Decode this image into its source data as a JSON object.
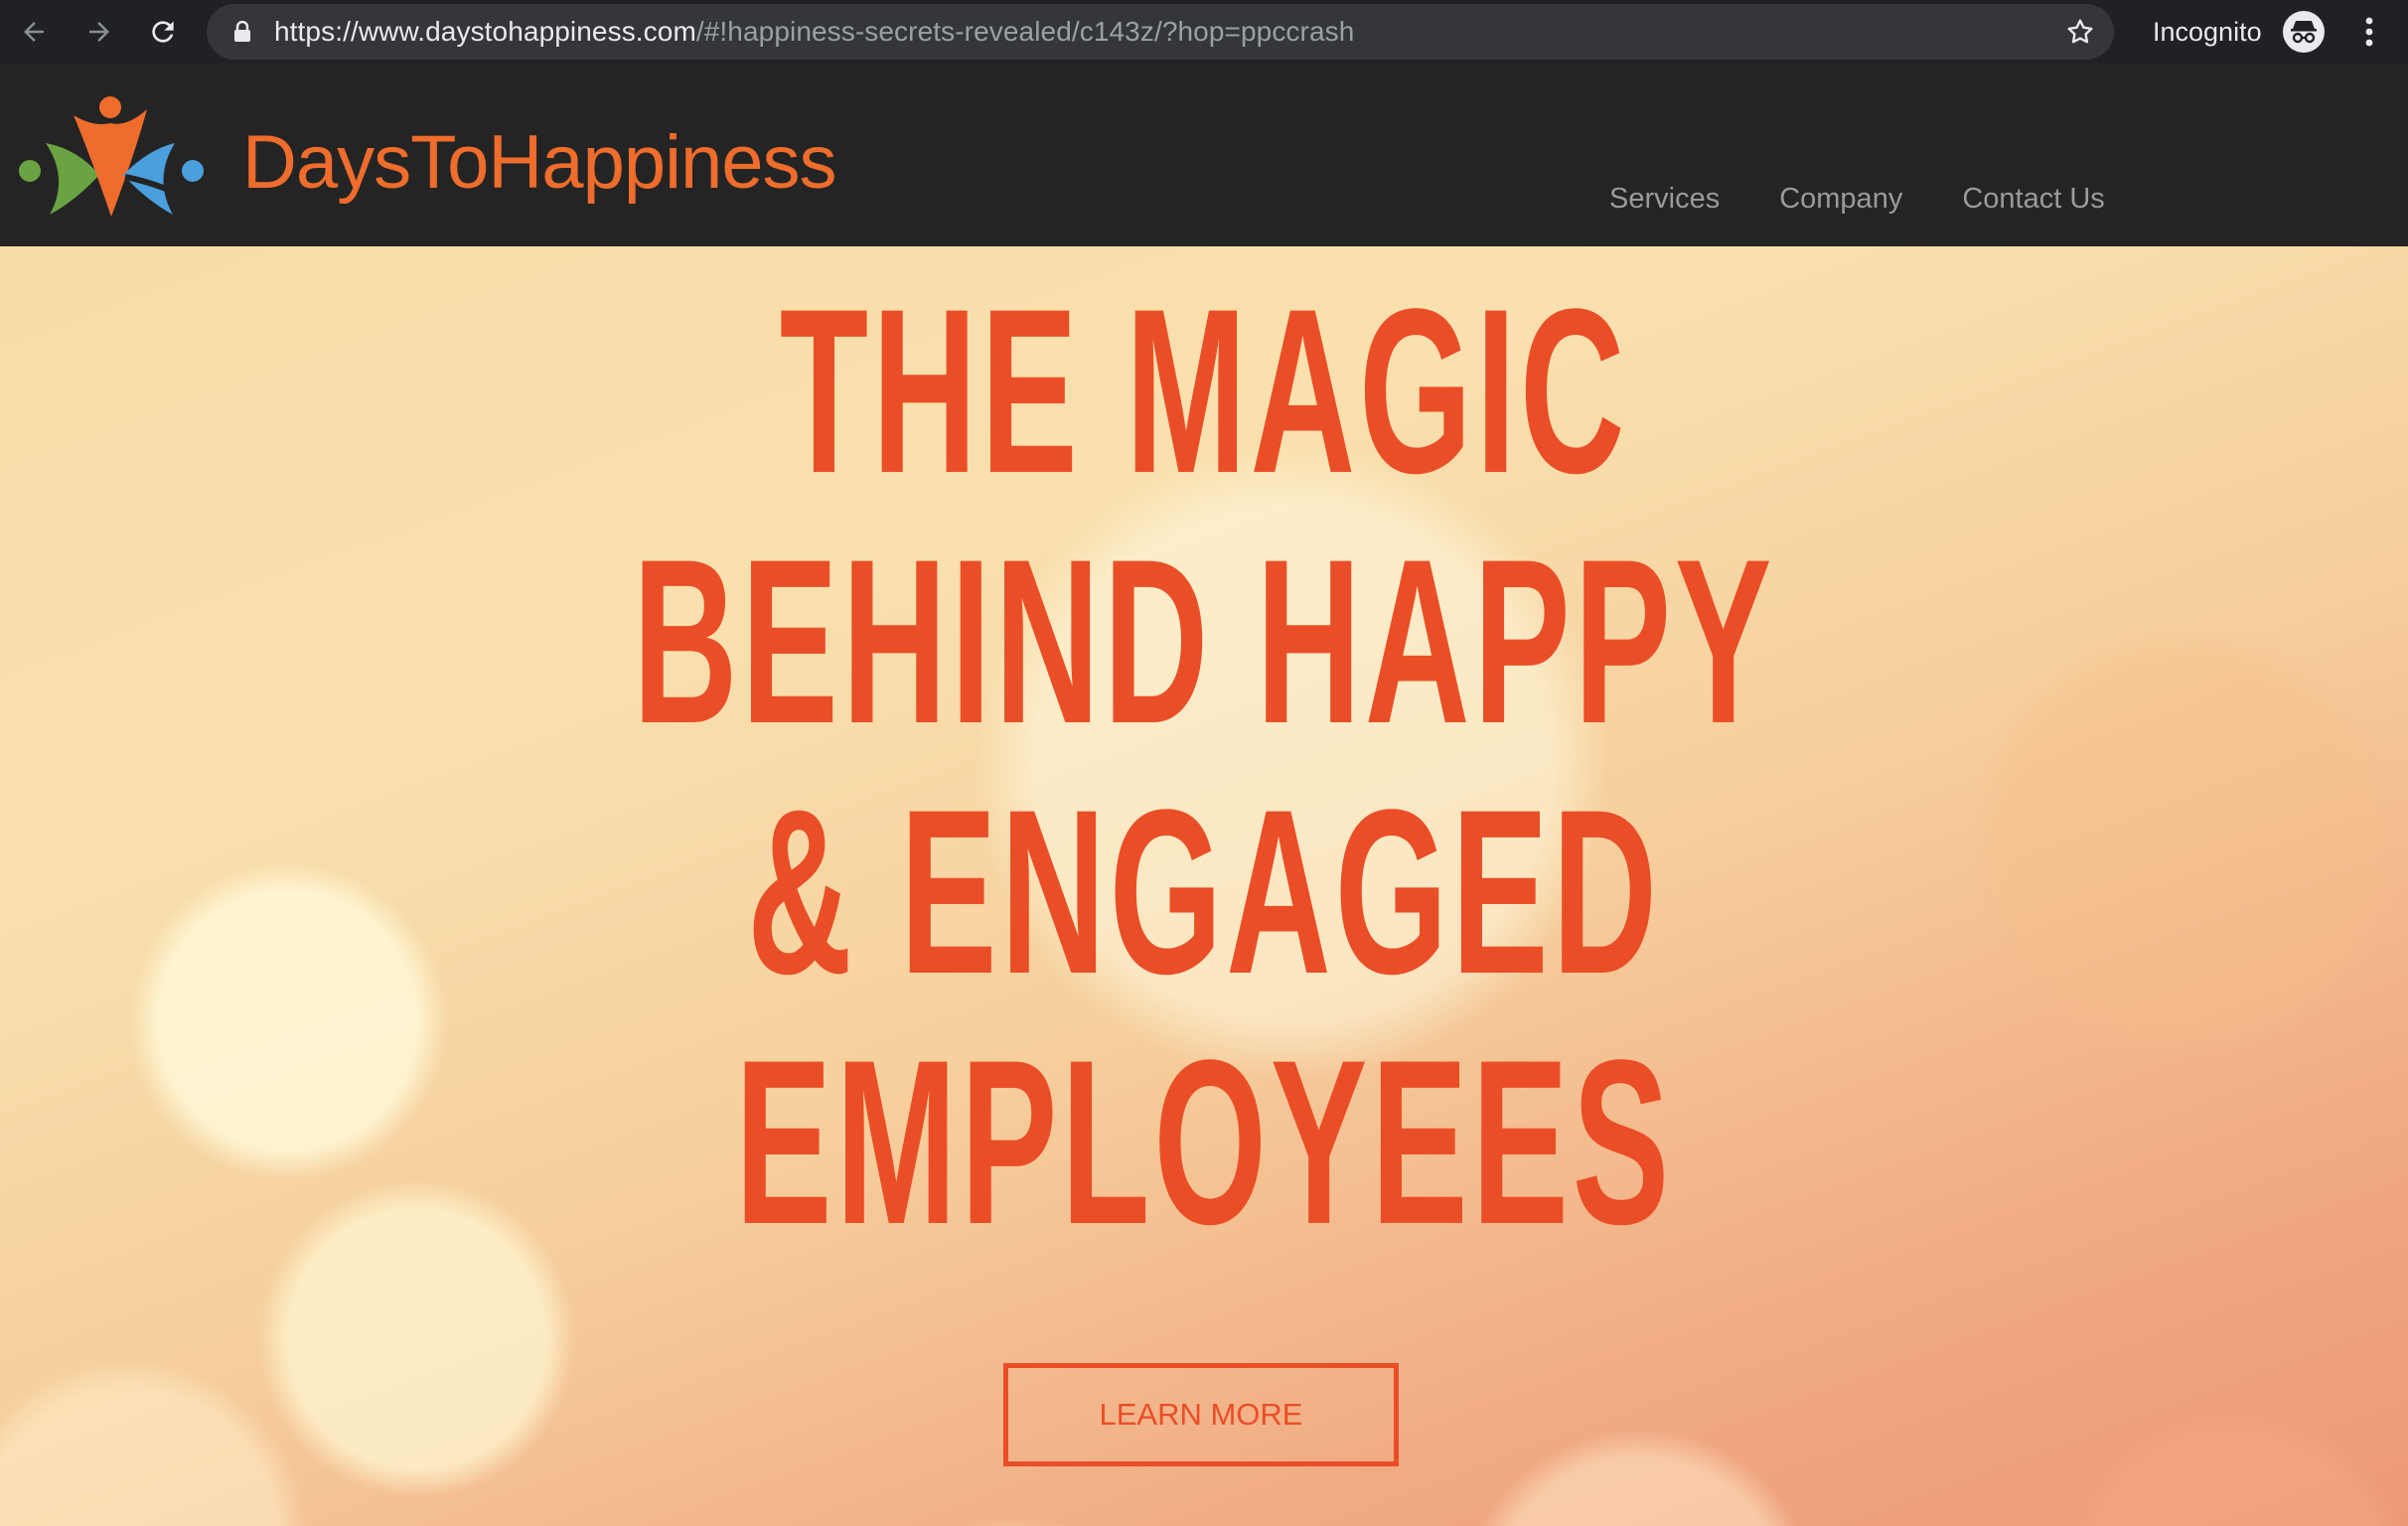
{
  "browser": {
    "url_host": "https://www.daystohappiness.com",
    "url_path": "/#!happiness-secrets-revealed/c143z/?hop=ppccrash",
    "incognito_label": "Incognito"
  },
  "site": {
    "brand_name": "DaysToHappiness",
    "nav": [
      {
        "label": "Services"
      },
      {
        "label": "Company"
      },
      {
        "label": "Contact Us"
      }
    ]
  },
  "hero": {
    "headline_lines": [
      "THE MAGIC",
      "BEHIND HAPPY",
      "& ENGAGED",
      "EMPLOYEES"
    ],
    "cta_label": "LEARN MORE"
  },
  "colors": {
    "accent": "#ea4e27",
    "brand_orange": "#ee6c2c",
    "header_bg": "#242424",
    "browser_bg": "#202124"
  },
  "icons": {
    "back": "arrow-left-icon",
    "forward": "arrow-right-icon",
    "reload": "reload-icon",
    "lock": "lock-icon",
    "star": "star-icon",
    "incognito": "incognito-icon",
    "menu": "more-vertical-icon"
  }
}
